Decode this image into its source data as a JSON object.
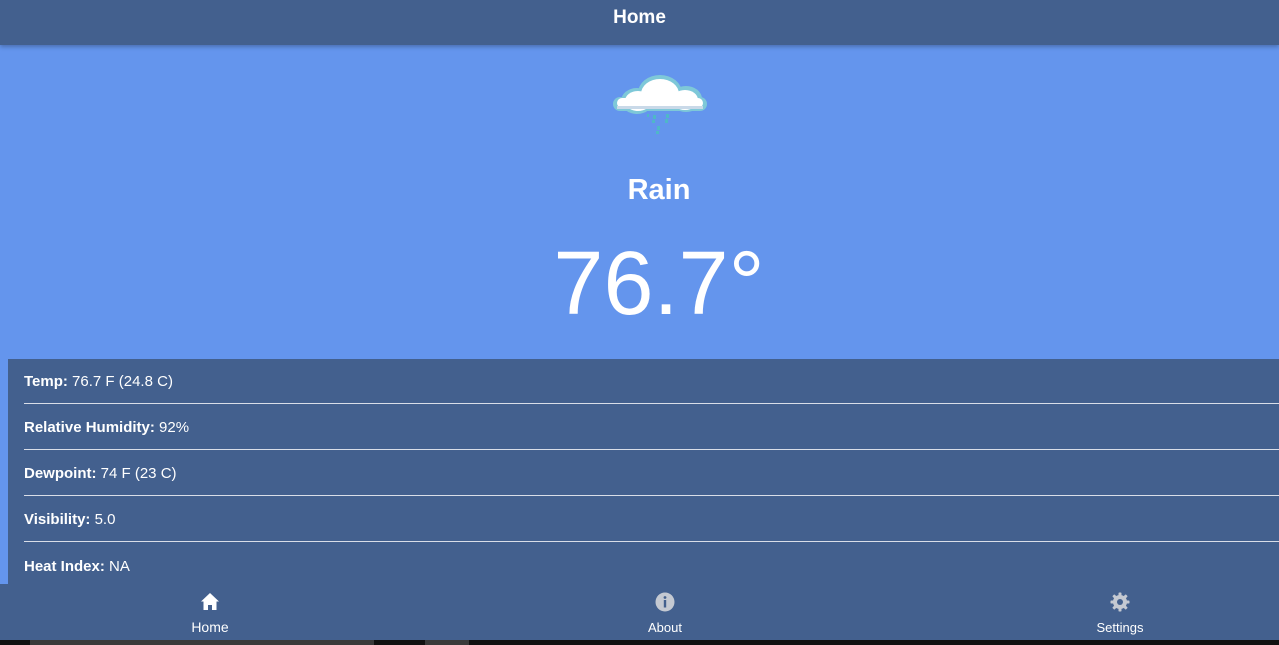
{
  "header": {
    "title": "Home"
  },
  "current": {
    "icon": "rain-cloud-icon",
    "condition": "Rain",
    "temperature": "76.7°"
  },
  "details": [
    {
      "label": "Temp:",
      "value": " 76.7 F (24.8 C)"
    },
    {
      "label": "Relative Humidity:",
      "value": " 92%"
    },
    {
      "label": "Dewpoint:",
      "value": " 74 F (23 C)"
    },
    {
      "label": "Visibility:",
      "value": " 5.0"
    },
    {
      "label": "Heat Index:",
      "value": " NA"
    }
  ],
  "tabs": [
    {
      "label": "Home",
      "icon": "home-icon",
      "active": true
    },
    {
      "label": "About",
      "icon": "info-icon",
      "active": false
    },
    {
      "label": "Settings",
      "icon": "gear-icon",
      "active": false
    }
  ],
  "colors": {
    "background": "#6495ed",
    "bars": "#43608e",
    "text": "#ffffff"
  }
}
